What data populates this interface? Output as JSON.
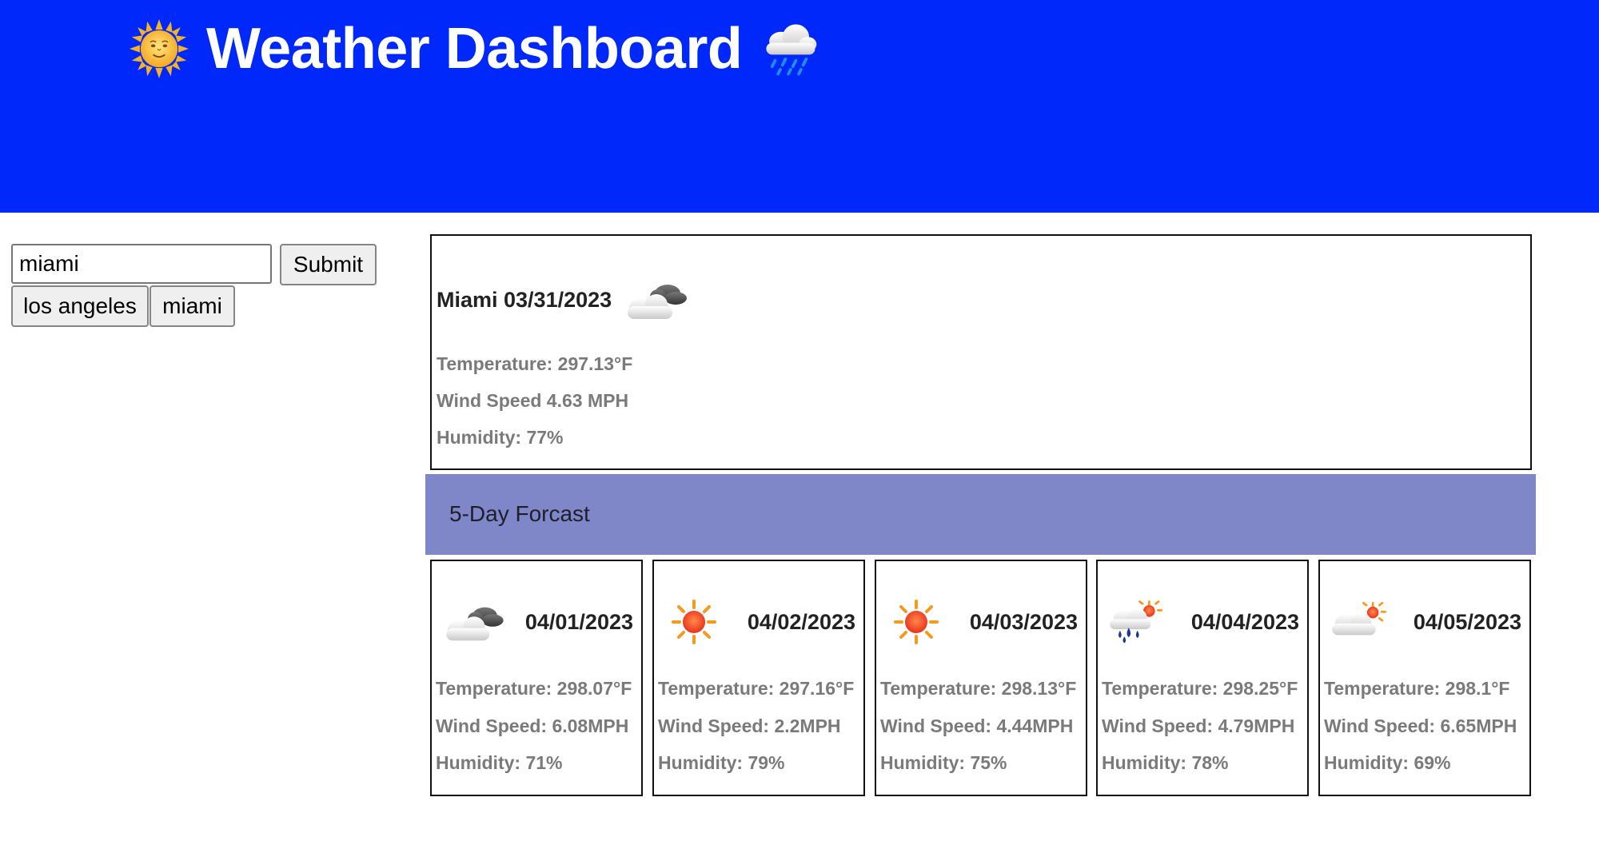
{
  "header": {
    "title": "Weather Dashboard",
    "left_icon": "sun-with-face-icon",
    "right_icon": "cloud-with-rain-icon",
    "background": "#0128fa"
  },
  "search": {
    "value": "miami",
    "submit_label": "Submit",
    "history": [
      "los angeles",
      "miami"
    ]
  },
  "current": {
    "heading": "Miami 03/31/2023",
    "icon": "cloud-icon",
    "temperature": "Temperature: 297.13°F",
    "wind": "Wind Speed 4.63 MPH",
    "humidity": "Humidity: 77%"
  },
  "forecast": {
    "heading": "5-Day Forcast",
    "band_color": "#7f87c9",
    "days": [
      {
        "date": "04/01/2023",
        "icon": "cloud-icon",
        "temperature": "Temperature: 298.07°F",
        "wind": "Wind Speed: 6.08MPH",
        "humidity": "Humidity: 71%"
      },
      {
        "date": "04/02/2023",
        "icon": "sun-icon",
        "temperature": "Temperature: 297.16°F",
        "wind": "Wind Speed: 2.2MPH",
        "humidity": "Humidity: 79%"
      },
      {
        "date": "04/03/2023",
        "icon": "sun-icon",
        "temperature": "Temperature: 298.13°F",
        "wind": "Wind Speed: 4.44MPH",
        "humidity": "Humidity: 75%"
      },
      {
        "date": "04/04/2023",
        "icon": "rain-sun-cloud-icon",
        "temperature": "Temperature: 298.25°F",
        "wind": "Wind Speed: 4.79MPH",
        "humidity": "Humidity: 78%"
      },
      {
        "date": "04/05/2023",
        "icon": "sun-behind-cloud-icon",
        "temperature": "Temperature: 298.1°F",
        "wind": "Wind Speed: 6.65MPH",
        "humidity": "Humidity: 69%"
      }
    ]
  }
}
